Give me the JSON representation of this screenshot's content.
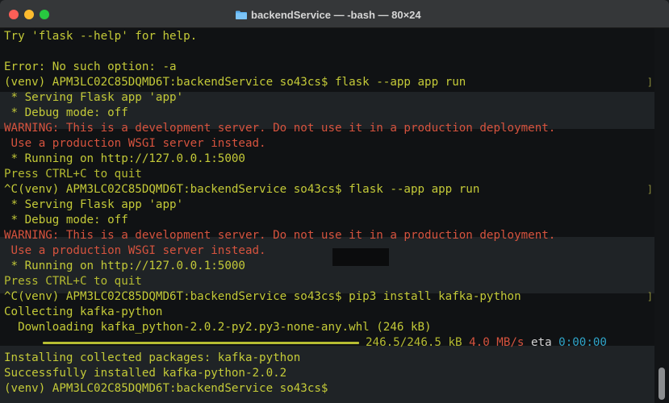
{
  "window": {
    "title": "backendService — -bash — 80×24",
    "folder_icon": "folder-icon"
  },
  "colors": {
    "yellow_text": "#c4ca38",
    "red_warning": "#d6533e",
    "green_text": "#b5bb31",
    "cyan_eta": "#2fa4c8"
  },
  "terminal": {
    "lines": [
      {
        "text": "Try 'flask --help' for help.",
        "color": "yellow"
      },
      {
        "text": "",
        "color": "yellow"
      },
      {
        "text": "Error: No such option: -a",
        "color": "yellow"
      },
      {
        "text": "(venv) APM3LC02C85DQMD6T:backendService so43cs$ flask --app app run",
        "color": "yellow",
        "bracket": true
      },
      {
        "text": " * Serving Flask app 'app'",
        "color": "yellow"
      },
      {
        "text": " * Debug mode: off",
        "color": "yellow"
      },
      {
        "text": "WARNING: This is a development server. Do not use it in a production deployment.",
        "color": "red"
      },
      {
        "text": " Use a production WSGI server instead.",
        "color": "red"
      },
      {
        "text": " * Running on http://127.0.0.1:5000",
        "color": "yellow"
      },
      {
        "text": "Press CTRL+C to quit",
        "color": "green"
      },
      {
        "text": "^C(venv) APM3LC02C85DQMD6T:backendService so43cs$ flask --app app run",
        "color": "yellow",
        "bracket": true
      },
      {
        "text": " * Serving Flask app 'app'",
        "color": "yellow"
      },
      {
        "text": " * Debug mode: off",
        "color": "yellow"
      },
      {
        "text": "WARNING: This is a development server. Do not use it in a production deployment.",
        "color": "red"
      },
      {
        "text": " Use a production WSGI server instead.",
        "color": "red"
      },
      {
        "text": " * Running on http://127.0.0.1:5000",
        "color": "yellow"
      },
      {
        "text": "Press CTRL+C to quit",
        "color": "green"
      },
      {
        "text": "^C(venv) APM3LC02C85DQMD6T:backendService so43cs$ pip3 install kafka-python",
        "color": "yellow",
        "bracket": true
      },
      {
        "text": "Collecting kafka-python",
        "color": "yellow"
      },
      {
        "text": "  Downloading kafka_python-2.0.2-py2.py3-none-any.whl (246 kB)",
        "color": "yellow"
      }
    ],
    "progress": {
      "fraction": 1.0,
      "size_text": "246.5/246.5 kB",
      "speed_text": "4.0 MB/s",
      "eta_label": "eta",
      "eta_value": "0:00:00"
    },
    "tail_lines": [
      {
        "text": "Installing collected packages: kafka-python",
        "color": "yellow"
      },
      {
        "text": "Successfully installed kafka-python-2.0.2",
        "color": "yellow"
      },
      {
        "text": "(venv) APM3LC02C85DQMD6T:backendService so43cs$ ",
        "color": "yellow"
      }
    ]
  }
}
